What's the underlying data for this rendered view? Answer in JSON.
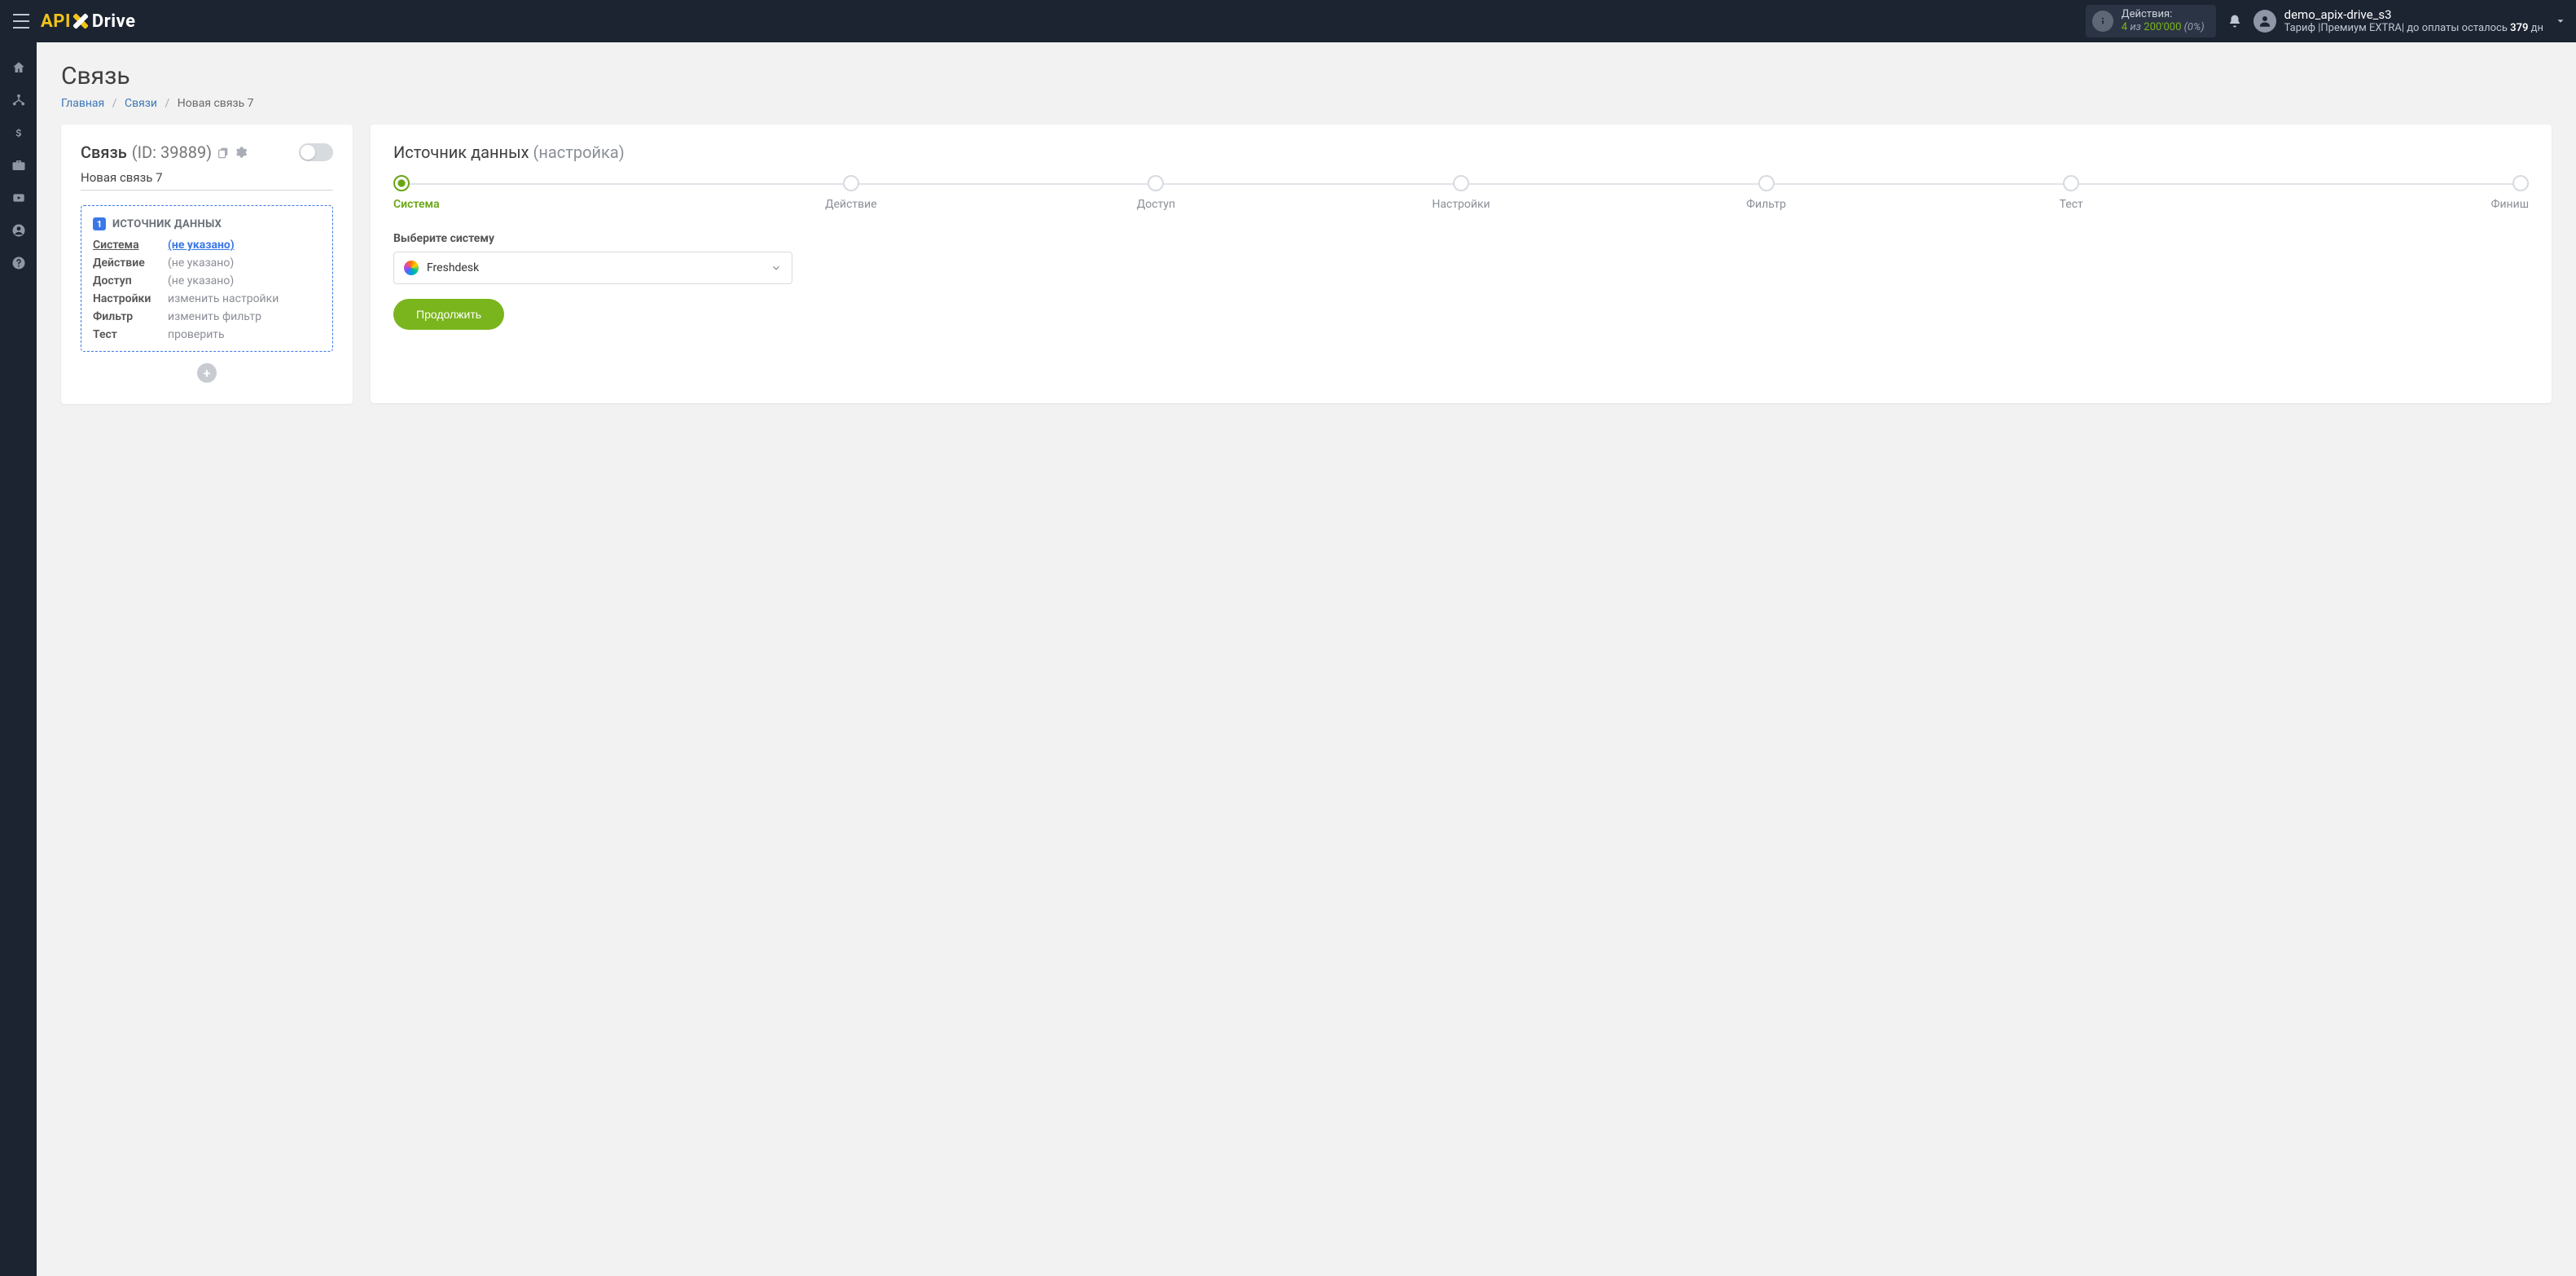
{
  "header": {
    "logo": {
      "part1": "API",
      "part2": "Drive"
    },
    "actions": {
      "label": "Действия:",
      "used": "4",
      "of_word": "из",
      "limit": "200'000",
      "percent": "(0%)"
    },
    "user": {
      "name": "demo_apix-drive_s3",
      "tariff_prefix": "Тариф |",
      "tariff_name": "Премиум EXTRA",
      "tariff_mid": "| до оплаты осталось ",
      "days": "379",
      "days_suffix": " дн"
    }
  },
  "sidebar": {
    "items": [
      "home",
      "connections",
      "payments",
      "briefcase",
      "video",
      "account",
      "help"
    ]
  },
  "page": {
    "title": "Связь",
    "breadcrumb": {
      "home": "Главная",
      "links": "Связи",
      "current": "Новая связь 7"
    }
  },
  "left": {
    "title": "Связь",
    "id_label": "(ID: 39889)",
    "connection_name": "Новая связь 7",
    "source_block": {
      "badge": "1",
      "title": "ИСТОЧНИК ДАННЫХ",
      "rows": [
        {
          "label": "Система",
          "value": "(не указано)",
          "active": true,
          "link": true
        },
        {
          "label": "Действие",
          "value": "(не указано)",
          "active": false,
          "link": false
        },
        {
          "label": "Доступ",
          "value": "(не указано)",
          "active": false,
          "link": false
        },
        {
          "label": "Настройки",
          "value": "изменить настройки",
          "active": false,
          "link": false
        },
        {
          "label": "Фильтр",
          "value": "изменить фильтр",
          "active": false,
          "link": false
        },
        {
          "label": "Тест",
          "value": "проверить",
          "active": false,
          "link": false
        }
      ]
    }
  },
  "right": {
    "title": "Источник данных",
    "subtitle": "(настройка)",
    "steps": [
      "Система",
      "Действие",
      "Доступ",
      "Настройки",
      "Фильтр",
      "Тест",
      "Финиш"
    ],
    "active_step": 0,
    "system_label": "Выберите систему",
    "system_value": "Freshdesk",
    "continue_label": "Продолжить"
  }
}
